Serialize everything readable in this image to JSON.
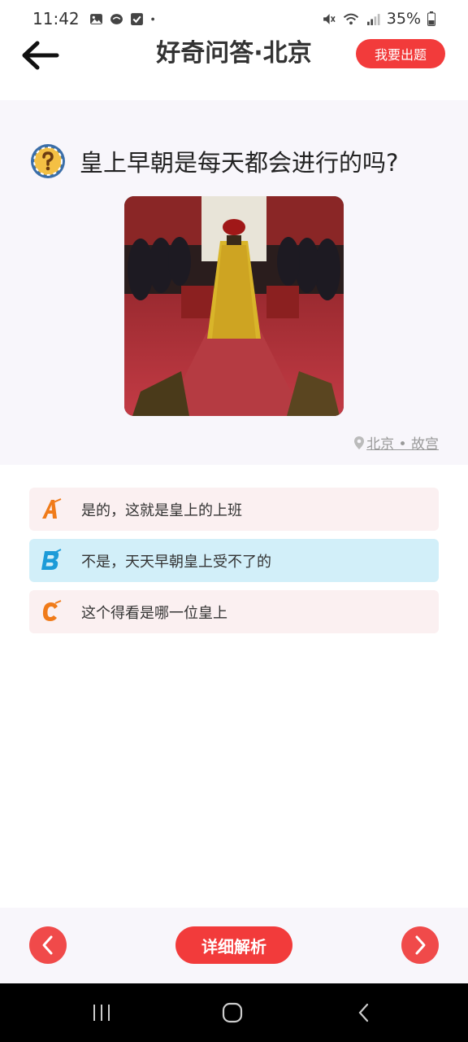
{
  "status_bar": {
    "time": "11:42",
    "battery": "35%",
    "left_icons": [
      "gallery-icon",
      "chat-icon",
      "checkbox-icon",
      "dot-icon"
    ],
    "right_icons": [
      "mute-icon",
      "wifi-icon",
      "signal-icon",
      "battery-icon"
    ]
  },
  "header": {
    "title": "好奇问答·北京",
    "ask_button": "我要出题"
  },
  "question": {
    "text": "皇上早朝是每天都会进行的吗?",
    "location": "北京 • 故宫"
  },
  "options": [
    {
      "letter": "A",
      "text": "是的，这就是皇上的上班",
      "selected": false
    },
    {
      "letter": "B",
      "text": "不是，天天早朝皇上受不了的",
      "selected": true
    },
    {
      "letter": "C",
      "text": "这个得看是哪一位皇上",
      "selected": false
    }
  ],
  "bottom": {
    "detail_button": "详细解析"
  },
  "colors": {
    "accent": "#f23b3b",
    "card_bg": "#f8f6fb",
    "option_bg": "#fbf0f1",
    "option_selected_bg": "#d2eff9"
  }
}
